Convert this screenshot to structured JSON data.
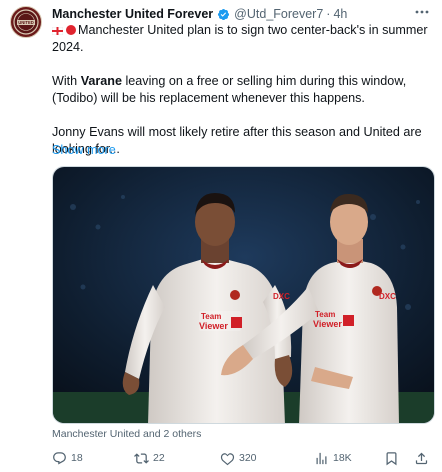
{
  "author": {
    "name": "Manchester United Forever",
    "handle": "@Utd_Forever7",
    "separator": "·",
    "time": "4h",
    "avatar_text": "UNITED"
  },
  "tweet": {
    "line1_text": "Manchester United plan is to sign two center-back's in summer 2024.",
    "p2_prefix": "With ",
    "p2_bold": "Varane",
    "p2_suffix": " leaving on a free or selling him during this window, (Todibo) will be his replacement whenever this happens.",
    "p3": "Jonny Evans will most likely retire after this season and United are looking for...",
    "show_more": "Show more"
  },
  "media": {
    "tagged": "Manchester United and 2 others",
    "player_left_sponsor": "Team\nViewer",
    "player_right_sponsor": "Team\nViewer",
    "kit_mark": "DXC"
  },
  "actions": {
    "replies": "18",
    "retweets": "22",
    "likes": "320",
    "views": "18K"
  },
  "colors": {
    "accent": "#1d9bf0",
    "muted": "#536471",
    "verified": "#1d9bf0"
  }
}
